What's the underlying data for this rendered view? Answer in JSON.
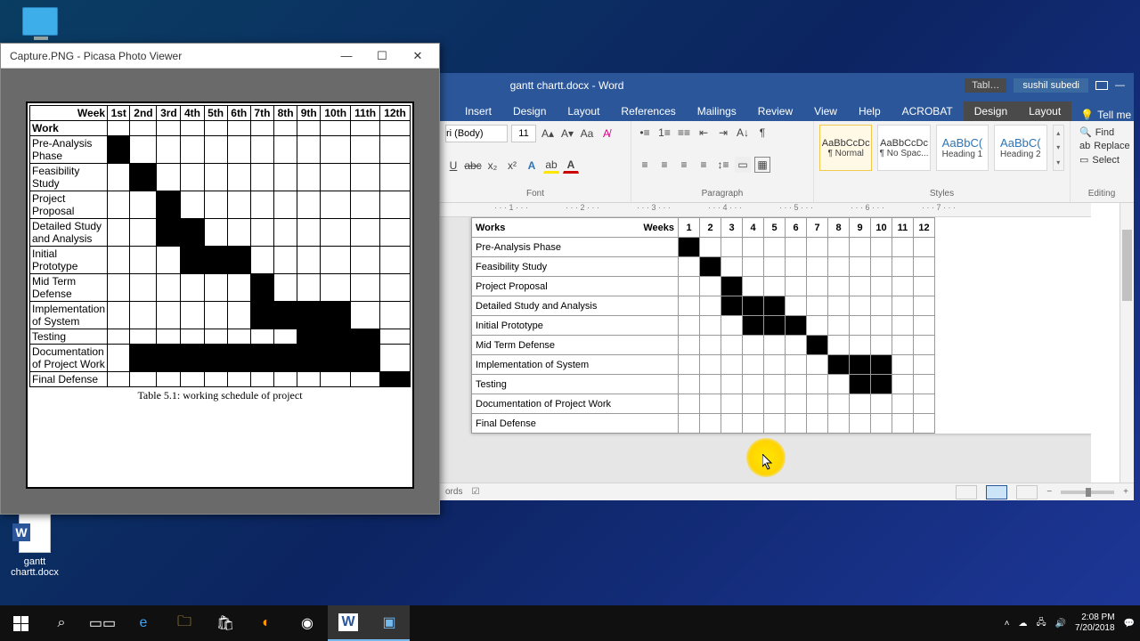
{
  "desktop": {
    "pc_label": "",
    "docx_label": "gantt chartt.docx"
  },
  "picasa": {
    "title": "Capture.PNG - Picasa Photo Viewer",
    "caption": "Table 5.1: working schedule of project",
    "week_header": "Week",
    "work_header": "Work",
    "cols": [
      "1st",
      "2nd",
      "3rd",
      "4th",
      "5th",
      "6th",
      "7th",
      "8th",
      "9th",
      "10th",
      "11th",
      "12th"
    ]
  },
  "word": {
    "title": "gantt chartt.docx - Word",
    "context_tab": "Tabl…",
    "user": "sushil subedi",
    "tabs": [
      "Insert",
      "Design",
      "Layout",
      "References",
      "Mailings",
      "Review",
      "View",
      "Help",
      "ACROBAT"
    ],
    "ctx_tabs": [
      "Design",
      "Layout"
    ],
    "tell_me": "Tell me",
    "font_name": "ri (Body)",
    "font_size": "11",
    "group_font": "Font",
    "group_para": "Paragraph",
    "group_styles": "Styles",
    "group_editing": "Editing",
    "styles": [
      {
        "sample": "AaBbCcDc",
        "name": "¶ Normal"
      },
      {
        "sample": "AaBbCcDc",
        "name": "¶ No Spac..."
      },
      {
        "sample": "AaBbC(",
        "name": "Heading 1"
      },
      {
        "sample": "AaBbC(",
        "name": "Heading 2"
      }
    ],
    "find": "Find",
    "replace": "Replace",
    "select": "Select",
    "status_words": "ords",
    "ruler_marks": [
      "1",
      "2",
      "3",
      "4",
      "5",
      "6",
      "7"
    ],
    "weeks_header": "Weeks",
    "works_header": "Works",
    "cols": [
      "1",
      "2",
      "3",
      "4",
      "5",
      "6",
      "7",
      "8",
      "9",
      "10",
      "11",
      "12"
    ]
  },
  "tray": {
    "time": "2:08 PM",
    "date": "7/20/2018"
  },
  "chart_data": [
    {
      "type": "bar",
      "title": "Table 5.1: working schedule of project",
      "xlabel": "Week",
      "ylabel": "Work",
      "categories": [
        "1st",
        "2nd",
        "3rd",
        "4th",
        "5th",
        "6th",
        "7th",
        "8th",
        "9th",
        "10th",
        "11th",
        "12th"
      ],
      "series": [
        {
          "name": "Pre-Analysis Phase",
          "bars": [
            1
          ]
        },
        {
          "name": "Feasibility Study",
          "bars": [
            2
          ]
        },
        {
          "name": "Project Proposal",
          "bars": [
            3
          ]
        },
        {
          "name": "Detailed Study and Analysis",
          "bars": [
            3,
            4
          ]
        },
        {
          "name": "Initial Prototype",
          "bars": [
            4,
            5,
            6
          ]
        },
        {
          "name": "Mid Term Defense",
          "bars": [
            7
          ]
        },
        {
          "name": "Implementation of System",
          "bars": [
            7,
            8,
            9,
            10
          ]
        },
        {
          "name": "Testing",
          "bars": [
            9,
            10,
            11
          ]
        },
        {
          "name": "Documentation of Project Work",
          "bars": [
            2,
            3,
            4,
            5,
            6,
            7,
            8,
            9,
            10,
            11
          ]
        },
        {
          "name": "Final Defense",
          "bars": [
            12
          ]
        }
      ]
    },
    {
      "type": "bar",
      "title": "gantt chartt.docx",
      "xlabel": "Weeks",
      "ylabel": "Works",
      "categories": [
        "1",
        "2",
        "3",
        "4",
        "5",
        "6",
        "7",
        "8",
        "9",
        "10",
        "11",
        "12"
      ],
      "series": [
        {
          "name": "Pre-Analysis Phase",
          "bars": [
            1
          ]
        },
        {
          "name": "Feasibility Study",
          "bars": [
            2
          ]
        },
        {
          "name": "Project Proposal",
          "bars": [
            3
          ]
        },
        {
          "name": "Detailed Study and Analysis",
          "bars": [
            3,
            4,
            5
          ]
        },
        {
          "name": "Initial Prototype",
          "bars": [
            4,
            5,
            6
          ]
        },
        {
          "name": "Mid Term Defense",
          "bars": [
            7
          ]
        },
        {
          "name": "Implementation of System",
          "bars": [
            8,
            9,
            10
          ]
        },
        {
          "name": "Testing",
          "bars": [
            9,
            10
          ]
        },
        {
          "name": "Documentation of Project Work",
          "bars": []
        },
        {
          "name": "Final Defense",
          "bars": []
        }
      ]
    }
  ]
}
